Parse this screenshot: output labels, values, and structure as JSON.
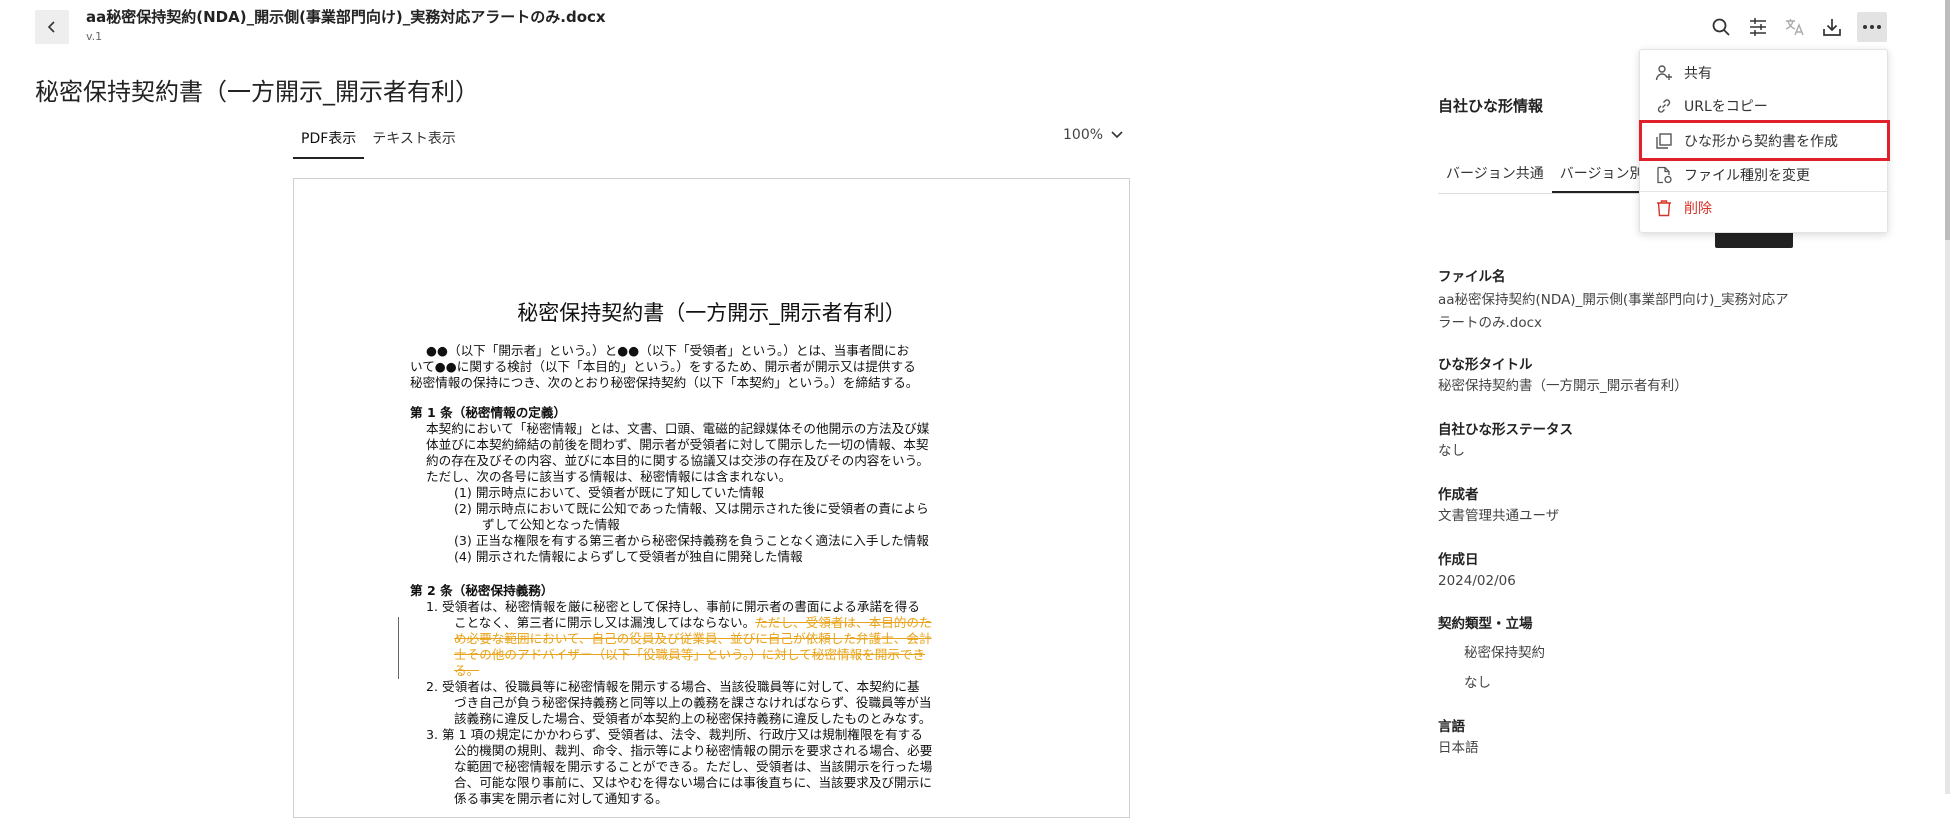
{
  "header": {
    "file_title": "aa秘密保持契約(NDA)_開示側(事業部門向け)_実務対応アラートのみ.docx",
    "version": "v.1"
  },
  "icons": {
    "back": "chevron-left-icon",
    "search": "search-icon",
    "compare": "compare-icon",
    "translate": "translate-icon",
    "download": "download-icon",
    "more": "more-icon"
  },
  "document": {
    "heading": "秘密保持契約書（一方開示_開示者有利）",
    "view_tabs": [
      "PDF表示",
      "テキスト表示"
    ],
    "zoom": "100%",
    "page": {
      "title": "秘密保持契約書（一方開示_開示者有利）",
      "lines": [
        "●●（以下「開示者」という。）と●●（以下「受領者」という。）とは、当事者間にお",
        "いて●●に関する検討（以下「本目的」という。）をするため、開示者が開示又は提供する",
        "秘密情報の保持につき、次のとおり秘密保持契約（以下「本契約」という。）を締結する。",
        "第 1 条（秘密情報の定義）",
        "本契約において「秘密情報」とは、文書、口頭、電磁的記録媒体その他開示の方法及び媒",
        "体並びに本契約締結の前後を問わず、開示者が受領者に対して開示した一切の情報、本契",
        "約の存在及びその内容、並びに本目的に関する協議又は交渉の存在及びその内容をいう。",
        "ただし、次の各号に該当する情報は、秘密情報には含まれない。",
        "(1)  開示時点において、受領者が既に了知していた情報",
        "(2)  開示時点において既に公知であった情報、又は開示された後に受領者の責によら",
        "ずして公知となった情報",
        "(3)  正当な権限を有する第三者から秘密保持義務を負うことなく適法に入手した情報",
        "(4)  開示された情報によらずして受領者が独自に開発した情報",
        "第 2 条（秘密保持義務）",
        "1.    受領者は、秘密情報を厳に秘密として保持し、事前に開示者の書面による承諾を得る",
        "ことなく、第三者に開示し又は漏洩してはならない。",
        "ただし、受領者は、本目的のた",
        "め必要な範囲において、自己の役員及び従業員、並びに自己が依頼した弁護士、会計",
        "士その他のアドバイザー（以下「役職員等」という。）に対して秘密情報を開示でき",
        "る。",
        "2.    受領者は、役職員等に秘密情報を開示する場合、当該役職員等に対して、本契約に基",
        "づき自己が負う秘密保持義務と同等以上の義務を課さなければならず、役職員等が当",
        "該義務に違反した場合、受領者が本契約上の秘密保持義務に違反したものとみなす。",
        "3.    第 1 項の規定にかかわらず、受領者は、法令、裁判所、行政庁又は規制権限を有する",
        "公的機関の規則、裁判、命令、指示等により秘密情報の開示を要求される場合、必要",
        "な範囲で秘密情報を開示することができる。ただし、受領者は、当該開示を行った場",
        "合、可能な限り事前に、又はやむを得ない場合には事後直ちに、当該要求及び開示に",
        "係る事実を開示者に対して通知する。"
      ]
    }
  },
  "side_panel": {
    "title": "自社ひな形情報",
    "tabs": [
      "バージョン共通",
      "バージョン別"
    ],
    "fields": {
      "file_name_label": "ファイル名",
      "file_name_value": "aa秘密保持契約(NDA)_開示側(事業部門向け)_実務対応アラートのみ.docx",
      "template_title_label": "ひな形タイトル",
      "template_title_value": "秘密保持契約書（一方開示_開示者有利）",
      "status_label": "自社ひな形ステータス",
      "status_value": "なし",
      "author_label": "作成者",
      "author_value": "文書管理共通ユーザ",
      "created_label": "作成日",
      "created_value": "2024/02/06",
      "contract_type_label": "契約類型・立場",
      "contract_type_value": "秘密保持契約",
      "position_value": "なし",
      "language_label": "言語",
      "language_value": "日本語"
    }
  },
  "menu": {
    "items": [
      {
        "label": "共有",
        "icon": "share-user-icon"
      },
      {
        "label": "URLをコピー",
        "icon": "link-icon"
      },
      {
        "label": "ひな形から契約書を作成",
        "icon": "copy-icon"
      },
      {
        "label": "ファイル種別を変更",
        "icon": "file-change-icon"
      },
      {
        "label": "削除",
        "icon": "trash-icon"
      }
    ],
    "highlight_color": "#e0202a",
    "danger_color": "#d7332a"
  }
}
